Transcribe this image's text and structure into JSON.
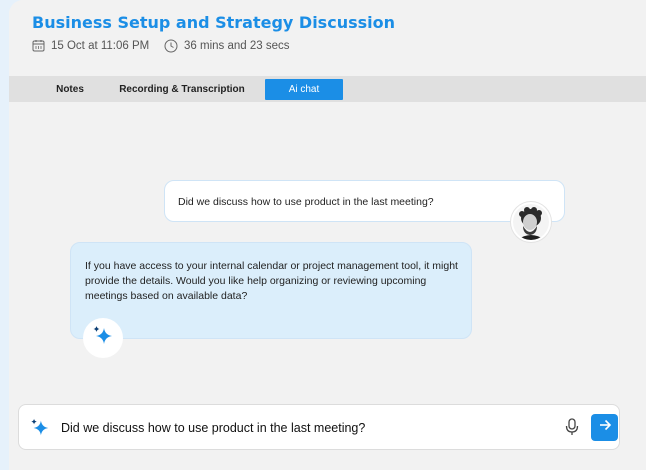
{
  "meeting": {
    "title": "Business Setup and Strategy Discussion",
    "date": "15 Oct at 11:06 PM",
    "duration": "36 mins and 23 secs"
  },
  "tabs": [
    {
      "label": "Notes",
      "active": false
    },
    {
      "label": "Recording & Transcription",
      "active": false
    },
    {
      "label": "Ai chat",
      "active": true
    }
  ],
  "chat": {
    "user_message": "Did we discuss how to use product in the last meeting?",
    "ai_message": " If you have access to your internal calendar or project management tool, it might provide the details. Would you like help organizing or reviewing upcoming meetings based on available data?"
  },
  "composer": {
    "value": "Did we discuss how to use product in the last meeting?"
  },
  "icons": {
    "date": "calendar-icon",
    "duration": "clock-icon",
    "ai": "sparkle-icon",
    "mic": "microphone-icon",
    "send": "arrow-right-icon"
  },
  "colors": {
    "accent": "#1b8ee6",
    "ai_bubble": "#dbeefb",
    "page_bg": "#e6f1fb",
    "panel_bg": "#f2f2f2"
  }
}
